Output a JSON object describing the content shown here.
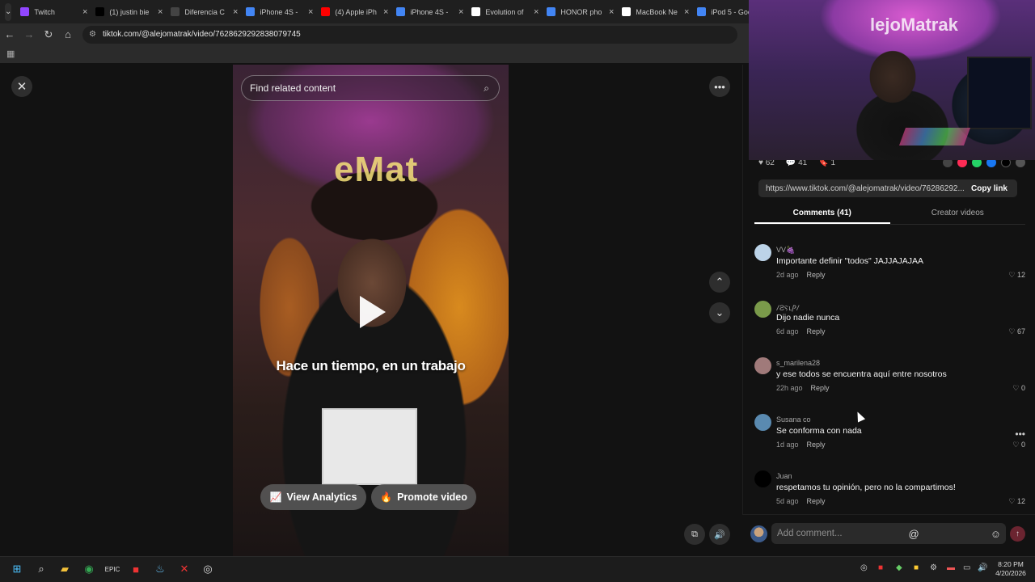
{
  "browser": {
    "tabs": [
      {
        "title": "Twitch",
        "icon": "twitch-icon",
        "color": "#9146ff"
      },
      {
        "title": "(1) justin bie",
        "icon": "x-icon",
        "color": "#000000"
      },
      {
        "title": "Diferencia C",
        "icon": "instagram-icon",
        "color": "#444444"
      },
      {
        "title": "iPhone 4S - ",
        "icon": "google-icon",
        "color": "#4285f4"
      },
      {
        "title": "(4) Apple iPh",
        "icon": "youtube-icon",
        "color": "#ff0000"
      },
      {
        "title": "iPhone 4S - ",
        "icon": "google-icon",
        "color": "#4285f4"
      },
      {
        "title": "Evolution of",
        "icon": "notion-icon",
        "color": "#ffffff"
      },
      {
        "title": "HONOR pho",
        "icon": "google-icon",
        "color": "#4285f4"
      },
      {
        "title": "MacBook Ne",
        "icon": "apple-icon",
        "color": "#ffffff"
      },
      {
        "title": "iPod 5 - Goo",
        "icon": "google-icon",
        "color": "#4285f4"
      }
    ],
    "url": "tiktok.com/@alejomatrak/video/7628629292838079745"
  },
  "video": {
    "search_placeholder": "Find related content",
    "neon_sign": "eMat",
    "caption": "Hace un tiempo, en un trabajo",
    "analytics_label": "View Analytics",
    "promote_label": "Promote video"
  },
  "webcam": {
    "sign_text": "lejoMatrak"
  },
  "panel": {
    "stats": {
      "likes": "62",
      "comments": "41",
      "saves": "1"
    },
    "link": "https://www.tiktok.com/@alejomatrak/video/76286292...",
    "copy_label": "Copy link",
    "tab_comments": "Comments (41)",
    "tab_creator": "Creator videos",
    "comments": [
      {
        "user": "VV🍇",
        "text": "Importante definir \"todos\" JAJJAJAJAA",
        "time": "2d ago",
        "reply": "Reply",
        "likes": "12",
        "avatar_color": "#bcd3e8"
      },
      {
        "user": "ⳆƧⲊⳑⳎⳆ",
        "text": "Dijo nadie nunca",
        "time": "6d ago",
        "reply": "Reply",
        "likes": "67",
        "avatar_color": "#7a9a4a"
      },
      {
        "user": "s_marilena28",
        "text": "y ese todos se encuentra aquí entre nosotros",
        "time": "22h ago",
        "reply": "Reply",
        "likes": "0",
        "avatar_color": "#a07a7a"
      },
      {
        "user": "Susana co",
        "text": "Se conforma con nada",
        "time": "1d ago",
        "reply": "Reply",
        "likes": "0",
        "avatar_color": "#5a8ab0"
      },
      {
        "user": "Juan",
        "text": "respetamos tu opinión, pero no la compartimos!",
        "time": "5d ago",
        "reply": "Reply",
        "likes": "12",
        "avatar_color": "#000000"
      }
    ],
    "comment_placeholder": "Add comment..."
  },
  "taskbar": {
    "time": "8:20 PM",
    "date": "4/20/2026"
  }
}
